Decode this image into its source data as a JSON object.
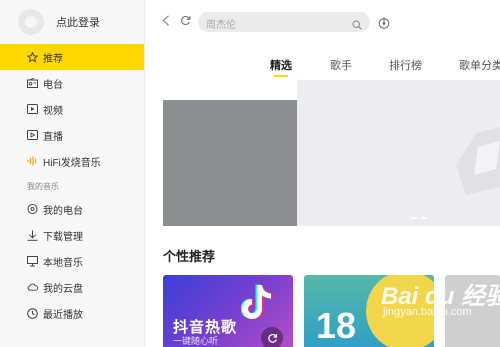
{
  "sidebar": {
    "login_label": "点此登录",
    "items": [
      {
        "label": "推荐",
        "icon": "star-icon",
        "active": true
      },
      {
        "label": "电台",
        "icon": "radio-icon"
      },
      {
        "label": "视频",
        "icon": "video-icon"
      },
      {
        "label": "直播",
        "icon": "live-icon"
      },
      {
        "label": "HiFi发烧音乐",
        "icon": "hifi-wave-icon"
      }
    ],
    "section_label": "我的音乐",
    "my_items": [
      {
        "label": "我的电台",
        "icon": "location-radio-icon"
      },
      {
        "label": "下载管理",
        "icon": "download-icon"
      },
      {
        "label": "本地音乐",
        "icon": "monitor-icon"
      },
      {
        "label": "我的云盘",
        "icon": "cloud-icon"
      },
      {
        "label": "最近播放",
        "icon": "clock-icon"
      }
    ]
  },
  "search": {
    "placeholder": "周杰伦"
  },
  "tabs": [
    {
      "label": "精选",
      "active": true
    },
    {
      "label": "歌手"
    },
    {
      "label": "排行榜"
    },
    {
      "label": "歌单分类"
    }
  ],
  "section": {
    "title": "个性推荐"
  },
  "cards": [
    {
      "title": "抖音热歌",
      "subtitle": "一键随心听",
      "icon": "tiktok-icon"
    },
    {
      "number": "18"
    }
  ],
  "watermark": {
    "logo": "Bai du 经验",
    "url": "jingyan.baidu.com"
  },
  "colors": {
    "accent": "#ffd800",
    "sidebar_bg": "#f7f7f7",
    "banner_left": "#8d8e90",
    "banner_right": "#ededf0"
  }
}
